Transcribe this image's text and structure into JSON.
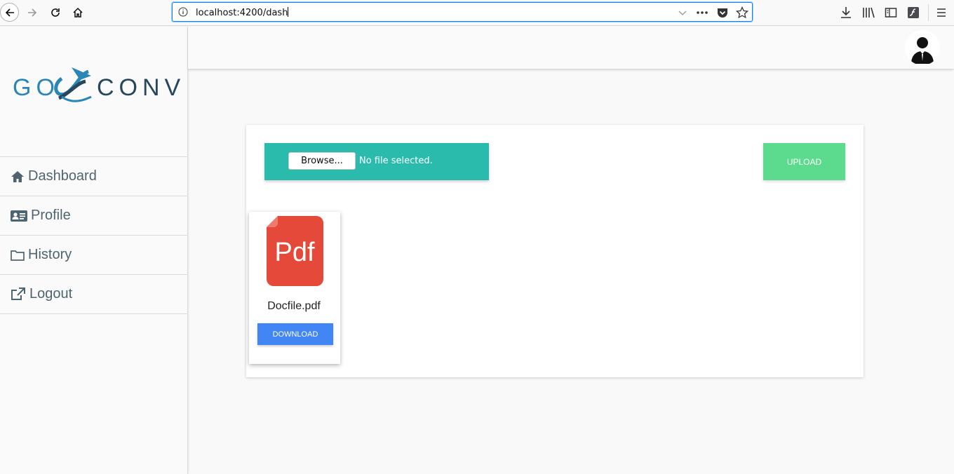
{
  "browser": {
    "url": "localhost:4200/dash",
    "icons": [
      "back-icon",
      "forward-icon",
      "reload-icon",
      "home-icon",
      "info-icon",
      "dropdown-icon",
      "more-icon",
      "pocket-icon",
      "bookmark-star-icon",
      "download-icon",
      "library-icon",
      "reader-icon",
      "flash-icon",
      "hamburger-menu-icon"
    ]
  },
  "sidebar": {
    "logo_text_left": "GO",
    "logo_text_right": "CONV",
    "items": [
      {
        "label": "Dashboard",
        "icon": "home-icon"
      },
      {
        "label": "Profile",
        "icon": "id-card-icon"
      },
      {
        "label": "History",
        "icon": "folder-icon"
      },
      {
        "label": "Logout",
        "icon": "external-link-icon"
      }
    ]
  },
  "header": {
    "avatar_icon": "user-avatar-icon"
  },
  "upload": {
    "browse_label": "Browse...",
    "status_text": "No file selected.",
    "upload_label": "UPLOAD"
  },
  "files": [
    {
      "name": "Docfile.pdf",
      "icon_text": "Pdf",
      "download_label": "DOWNLOAD"
    }
  ],
  "colors": {
    "teal": "#2bbbad",
    "green": "#5cdb8e",
    "blue": "#4285f4",
    "pdf_red": "#e5493a",
    "logo_blue": "#2a86b8",
    "logo_dark": "#27475a"
  }
}
